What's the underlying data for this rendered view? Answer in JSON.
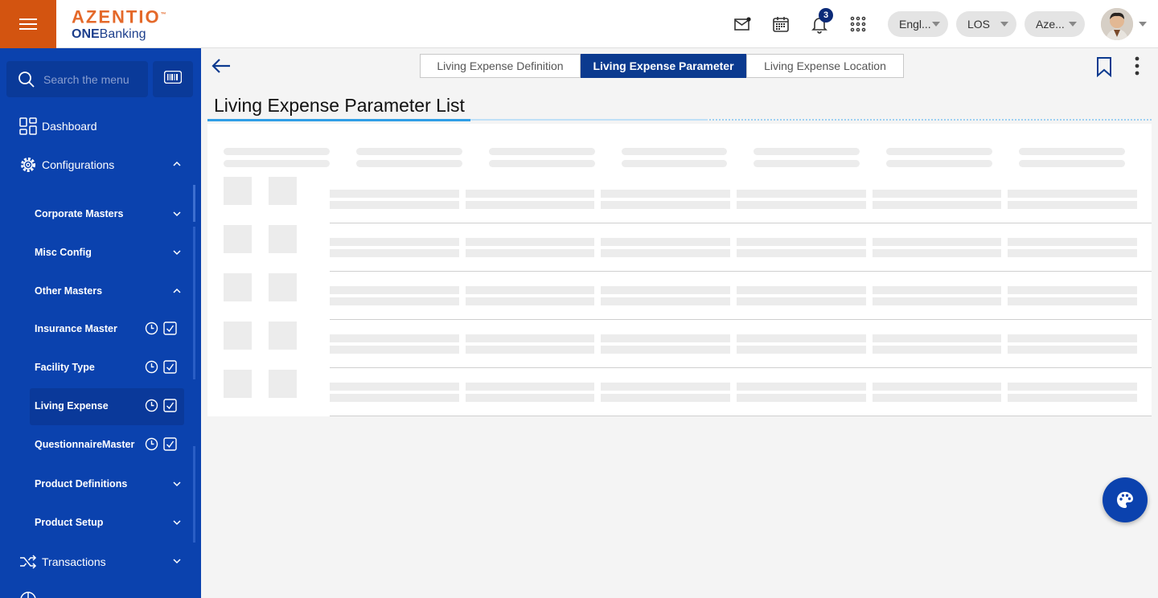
{
  "brand": {
    "name": "AZENTIO",
    "tm": "™",
    "sub_bold": "ONE",
    "sub_rest": "Banking"
  },
  "header": {
    "notification_count": "3",
    "language": "Engl...",
    "module": "LOS",
    "entity": "Aze..."
  },
  "sidebar": {
    "search_placeholder": "Search the menu",
    "dashboard": "Dashboard",
    "configurations": "Configurations",
    "sub": {
      "corporate_masters": "Corporate Masters",
      "misc_config": "Misc Config",
      "other_masters": "Other Masters",
      "insurance_master": "Insurance Master",
      "facility_type": "Facility Type",
      "living_expense": "Living Expense",
      "questionnaire_master": "QuestionnaireMaster",
      "product_definitions": "Product Definitions",
      "product_setup": "Product Setup"
    },
    "transactions": "Transactions"
  },
  "tabs": {
    "definition": "Living Expense Definition",
    "parameter": "Living Expense Parameter",
    "location": "Living Expense Location"
  },
  "page": {
    "title": "Living Expense Parameter List"
  },
  "colors": {
    "sidebar": "#0b42ae",
    "accent": "#d35410",
    "active_tab": "#0b3a8f"
  }
}
